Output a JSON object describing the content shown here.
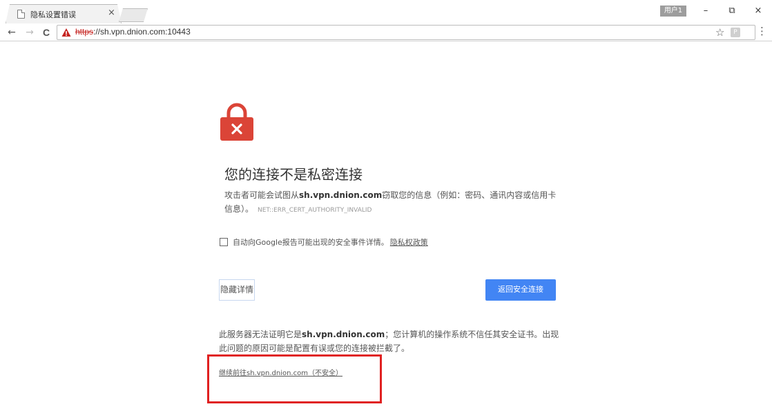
{
  "browser": {
    "tab_title": "隐私设置错误",
    "tab_close": "×",
    "user_label": "用户1",
    "url_scheme": "https",
    "url_rest": "://sh.vpn.dnion.com:10443"
  },
  "icons": {
    "back": "←",
    "forward": "→",
    "reload": "C",
    "star": "☆",
    "extension": "P",
    "menu": "⋮",
    "minimize": "–",
    "restore": "⧉",
    "close": "×"
  },
  "page": {
    "heading": "您的连接不是私密连接",
    "desc_prefix": "攻击者可能会试图从",
    "desc_host": "sh.vpn.dnion.com",
    "desc_suffix": "窃取您的信息（例如：密码、通讯内容或信用卡信息）。",
    "error_code": "NET::ERR_CERT_AUTHORITY_INVALID",
    "report_text": "自动向Google报告可能出现的安全事件详情。",
    "privacy_link": "隐私权政策",
    "details_button": "隐藏详情",
    "back_button": "返回安全连接",
    "explain_prefix": "此服务器无法证明它是",
    "explain_host": "sh.vpn.dnion.com",
    "explain_suffix": "；您计算机的操作系统不信任其安全证书。出现此问题的原因可能是配置有误或您的连接被拦截了。",
    "proceed_link": "继续前往sh.vpn.dnion.com（不安全）"
  },
  "colors": {
    "lock_red": "#db4437",
    "primary_blue": "#4285f4",
    "annotation_red": "#e02020"
  }
}
